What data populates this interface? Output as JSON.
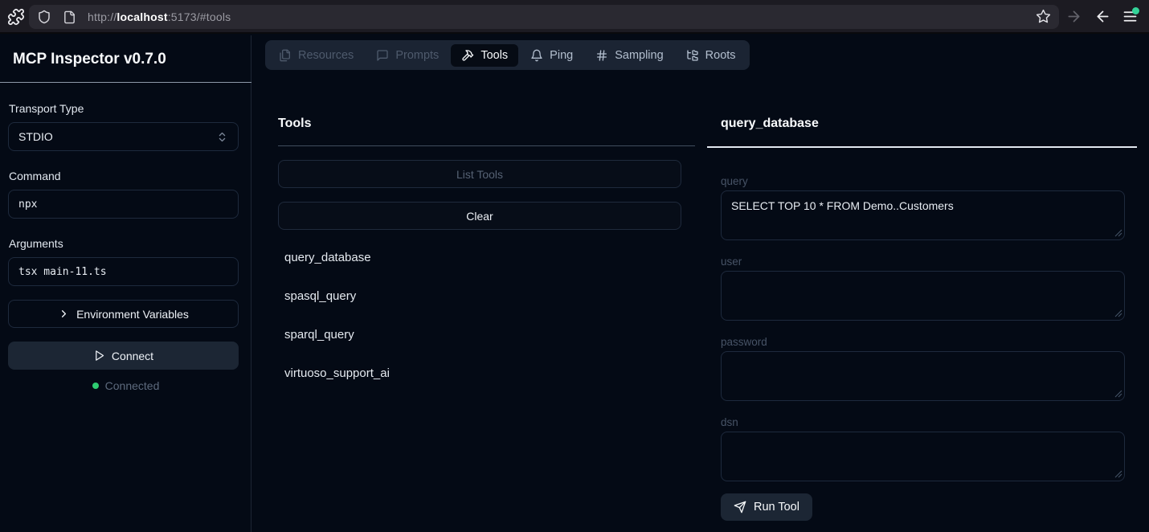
{
  "browser": {
    "url_prefix": "http://",
    "url_host": "localhost",
    "url_suffix": ":5173/#tools"
  },
  "sidebar": {
    "title": "MCP Inspector v0.7.0",
    "transport_label": "Transport Type",
    "transport_value": "STDIO",
    "command_label": "Command",
    "command_value": "npx",
    "arguments_label": "Arguments",
    "arguments_value": "tsx main-11.ts",
    "env_button_label": "Environment Variables",
    "connect_button_label": "Connect",
    "status_text": "Connected"
  },
  "tabs": [
    {
      "label": "Resources",
      "icon": "files-icon",
      "state": "disabled"
    },
    {
      "label": "Prompts",
      "icon": "message-square-icon",
      "state": "disabled"
    },
    {
      "label": "Tools",
      "icon": "hammer-icon",
      "state": "active"
    },
    {
      "label": "Ping",
      "icon": "bell-icon",
      "state": "enabled"
    },
    {
      "label": "Sampling",
      "icon": "hash-icon",
      "state": "enabled"
    },
    {
      "label": "Roots",
      "icon": "folder-tree-icon",
      "state": "enabled"
    }
  ],
  "tools_panel": {
    "title": "Tools",
    "list_tools_label": "List Tools",
    "clear_label": "Clear",
    "items": [
      "query_database",
      "spasql_query",
      "sparql_query",
      "virtuoso_support_ai"
    ]
  },
  "tool_detail": {
    "title": "query_database",
    "fields": [
      {
        "label": "query",
        "value": "SELECT TOP 10 * FROM Demo..Customers"
      },
      {
        "label": "user",
        "value": ""
      },
      {
        "label": "password",
        "value": ""
      },
      {
        "label": "dsn",
        "value": ""
      }
    ],
    "run_button_label": "Run Tool"
  },
  "colors": {
    "app_background": "#040a15",
    "chrome_background": "#1c1b22",
    "urlbar_background": "#2a2931",
    "panel_border": "#1e2a3d",
    "active_tab_background": "#060b14",
    "tab_bar_background": "#1b2433",
    "connected_dot": "#2ecc71",
    "menu_badge": "#34d399",
    "heading_text": "#f8fafc",
    "muted_text": "#5d6a7d"
  }
}
